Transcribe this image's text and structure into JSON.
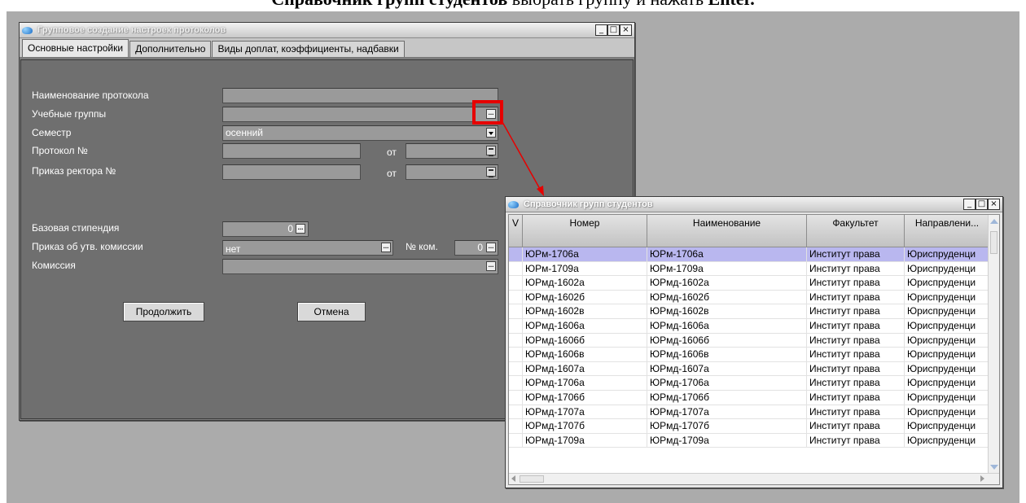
{
  "document": {
    "heading_bold": "Справочник групп студентов",
    "heading_rest": " выбрать группу и нажать ",
    "heading_key": "Enter."
  },
  "main_window": {
    "title": "Групповое создание настроек протоколов",
    "controls": {
      "minimize": "_",
      "maximize": "□",
      "close": "×"
    },
    "tabs": [
      "Основные настройки",
      "Дополнительно",
      "Виды доплат, коэффициенты, надбавки"
    ],
    "form": {
      "protocol_name_label": "Наименование протокола",
      "protocol_name_value": "",
      "groups_label": "Учебные группы",
      "groups_value": "",
      "semester_label": "Семестр",
      "semester_value": "осенний",
      "protocol_no_label": "Протокол №",
      "protocol_no_value": "",
      "from_label": "от",
      "rector_order_label": "Приказ ректора №",
      "rector_order_value": "",
      "from_label_2": "от",
      "base_stipend_label": "Базовая стипендия",
      "base_stipend_value": "0",
      "commission_order_label": "Приказ об утв. комиссии",
      "commission_order_value": "нет",
      "com_no_label": "№ ком.",
      "com_no_value": "0",
      "commission_label": "Комиссия",
      "commission_value": ""
    },
    "buttons": {
      "continue": "Продолжить",
      "cancel": "Отмена"
    },
    "ellipsis": "..."
  },
  "ref_window": {
    "title": "Справочник групп студентов",
    "controls": {
      "minimize": "_",
      "maximize": "□",
      "close": "×"
    },
    "columns": [
      "V",
      "Номер",
      "Наименование",
      "Факультет",
      "Направлени..."
    ],
    "rows": [
      [
        "",
        "ЮРм-1706а",
        "ЮРм-1706а",
        "Институт права",
        "Юриспруденци"
      ],
      [
        "",
        "ЮРм-1709а",
        "ЮРм-1709а",
        "Институт права",
        "Юриспруденци"
      ],
      [
        "",
        "ЮРмд-1602а",
        "ЮРмд-1602а",
        "Институт права",
        "Юриспруденци"
      ],
      [
        "",
        "ЮРмд-1602б",
        "ЮРмд-1602б",
        "Институт права",
        "Юриспруденци"
      ],
      [
        "",
        "ЮРмд-1602в",
        "ЮРмд-1602в",
        "Институт права",
        "Юриспруденци"
      ],
      [
        "",
        "ЮРмд-1606а",
        "ЮРмд-1606а",
        "Институт права",
        "Юриспруденци"
      ],
      [
        "",
        "ЮРмд-1606б",
        "ЮРмд-1606б",
        "Институт права",
        "Юриспруденци"
      ],
      [
        "",
        "ЮРмд-1606в",
        "ЮРмд-1606в",
        "Институт права",
        "Юриспруденци"
      ],
      [
        "",
        "ЮРмд-1607а",
        "ЮРмд-1607а",
        "Институт права",
        "Юриспруденци"
      ],
      [
        "",
        "ЮРмд-1706а",
        "ЮРмд-1706а",
        "Институт права",
        "Юриспруденци"
      ],
      [
        "",
        "ЮРмд-1706б",
        "ЮРмд-1706б",
        "Институт права",
        "Юриспруденци"
      ],
      [
        "",
        "ЮРмд-1707а",
        "ЮРмд-1707а",
        "Институт права",
        "Юриспруденци"
      ],
      [
        "",
        "ЮРмд-1707б",
        "ЮРмд-1707б",
        "Институт права",
        "Юриспруденци"
      ],
      [
        "",
        "ЮРмд-1709а",
        "ЮРмд-1709а",
        "Институт права",
        "Юриспруденци"
      ]
    ],
    "selected_row": 0
  },
  "colors": {
    "highlight": "#e60000",
    "selection": "#b9b7ef"
  }
}
